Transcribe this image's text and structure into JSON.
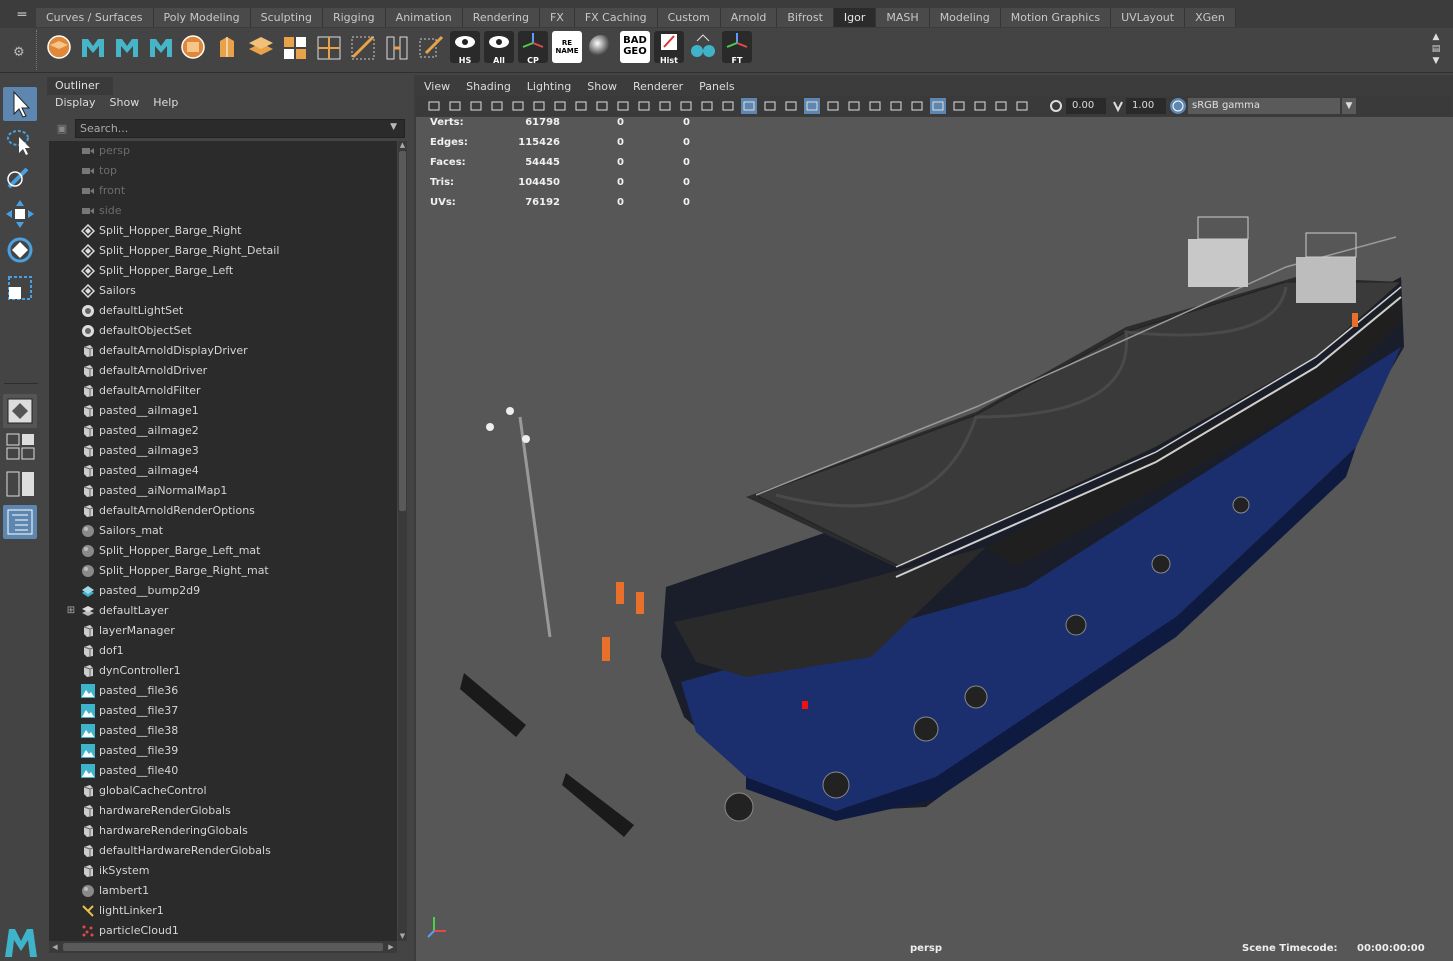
{
  "shelf": {
    "tabs": [
      "Curves / Surfaces",
      "Poly Modeling",
      "Sculpting",
      "Rigging",
      "Animation",
      "Rendering",
      "FX",
      "FX Caching",
      "Custom",
      "Arnold",
      "Bifrost",
      "Igor",
      "MASH",
      "Modeling",
      "Motion Graphics",
      "UVLayout",
      "XGen"
    ],
    "active_tab": "Igor",
    "button_labels": {
      "hs": "HS",
      "all": "All",
      "cp": "CP",
      "rename": "RE NAME",
      "badgeo": "BAD GEO",
      "hist": "Hist",
      "ft": "FT"
    }
  },
  "outliner": {
    "title": "Outliner",
    "menu": [
      "Display",
      "Show",
      "Help"
    ],
    "search_placeholder": "Search...",
    "items": [
      {
        "label": "persp",
        "icon": "camera-icon",
        "dim": true
      },
      {
        "label": "top",
        "icon": "camera-icon",
        "dim": true
      },
      {
        "label": "front",
        "icon": "camera-icon",
        "dim": true
      },
      {
        "label": "side",
        "icon": "camera-icon",
        "dim": true
      },
      {
        "label": "Split_Hopper_Barge_Right",
        "icon": "transform-icon"
      },
      {
        "label": "Split_Hopper_Barge_Right_Detail",
        "icon": "transform-icon"
      },
      {
        "label": "Split_Hopper_Barge_Left",
        "icon": "transform-icon"
      },
      {
        "label": "Sailors",
        "icon": "transform-icon"
      },
      {
        "label": "defaultLightSet",
        "icon": "set-icon"
      },
      {
        "label": "defaultObjectSet",
        "icon": "set-icon"
      },
      {
        "label": "defaultArnoldDisplayDriver",
        "icon": "node-icon"
      },
      {
        "label": "defaultArnoldDriver",
        "icon": "node-icon"
      },
      {
        "label": "defaultArnoldFilter",
        "icon": "node-icon"
      },
      {
        "label": "pasted__aiImage1",
        "icon": "node-icon"
      },
      {
        "label": "pasted__aiImage2",
        "icon": "node-icon"
      },
      {
        "label": "pasted__aiImage3",
        "icon": "node-icon"
      },
      {
        "label": "pasted__aiImage4",
        "icon": "node-icon"
      },
      {
        "label": "pasted__aiNormalMap1",
        "icon": "node-icon"
      },
      {
        "label": "defaultArnoldRenderOptions",
        "icon": "node-icon"
      },
      {
        "label": "Sailors_mat",
        "icon": "material-icon"
      },
      {
        "label": "Split_Hopper_Barge_Left_mat",
        "icon": "material-icon"
      },
      {
        "label": "Split_Hopper_Barge_Right_mat",
        "icon": "material-icon"
      },
      {
        "label": "pasted__bump2d9",
        "icon": "bump-icon"
      },
      {
        "label": "defaultLayer",
        "icon": "layer-icon",
        "expandable": true
      },
      {
        "label": "layerManager",
        "icon": "node-icon"
      },
      {
        "label": "dof1",
        "icon": "node-icon"
      },
      {
        "label": "dynController1",
        "icon": "node-icon"
      },
      {
        "label": "pasted__file36",
        "icon": "file-texture-icon"
      },
      {
        "label": "pasted__file37",
        "icon": "file-texture-icon"
      },
      {
        "label": "pasted__file38",
        "icon": "file-texture-icon"
      },
      {
        "label": "pasted__file39",
        "icon": "file-texture-icon"
      },
      {
        "label": "pasted__file40",
        "icon": "file-texture-icon"
      },
      {
        "label": "globalCacheControl",
        "icon": "node-icon"
      },
      {
        "label": "hardwareRenderGlobals",
        "icon": "node-icon"
      },
      {
        "label": "hardwareRenderingGlobals",
        "icon": "node-icon"
      },
      {
        "label": "defaultHardwareRenderGlobals",
        "icon": "node-icon"
      },
      {
        "label": "ikSystem",
        "icon": "node-icon"
      },
      {
        "label": "lambert1",
        "icon": "material-icon"
      },
      {
        "label": "lightLinker1",
        "icon": "light-linker-icon"
      },
      {
        "label": "particleCloud1",
        "icon": "particle-icon"
      }
    ]
  },
  "viewport": {
    "menu": [
      "View",
      "Shading",
      "Lighting",
      "Show",
      "Renderer",
      "Panels"
    ],
    "exposure": "0.00",
    "gamma": "1.00",
    "color_space": "sRGB gamma",
    "hud": {
      "rows": [
        {
          "label": "Verts:",
          "v1": "61798",
          "v2": "0",
          "v3": "0"
        },
        {
          "label": "Edges:",
          "v1": "115426",
          "v2": "0",
          "v3": "0"
        },
        {
          "label": "Faces:",
          "v1": "54445",
          "v2": "0",
          "v3": "0"
        },
        {
          "label": "Tris:",
          "v1": "104450",
          "v2": "0",
          "v3": "0"
        },
        {
          "label": "UVs:",
          "v1": "76192",
          "v2": "0",
          "v3": "0"
        }
      ]
    },
    "camera": "persp",
    "timecode_label": "Scene Timecode:",
    "timecode_value": "00:00:00:00"
  },
  "colors": {
    "accent": "#5d87b0",
    "hull_blue": "#1b2f6e",
    "maya_teal": "#3fb3c9"
  }
}
